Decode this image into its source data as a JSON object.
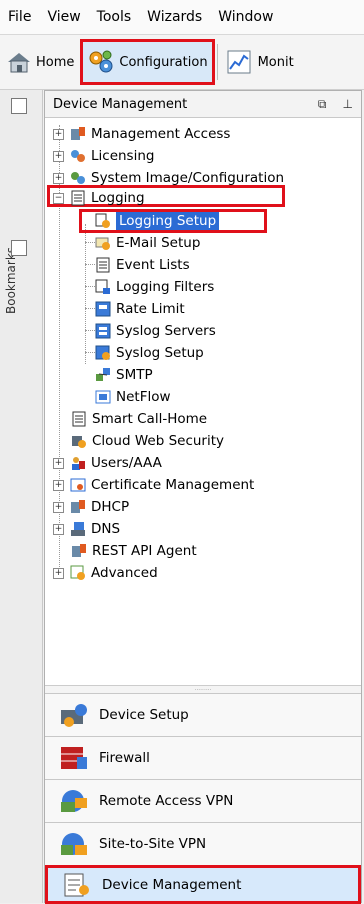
{
  "menubar": {
    "items": [
      "File",
      "View",
      "Tools",
      "Wizards",
      "Window"
    ]
  },
  "toolbar": {
    "home": "Home",
    "configuration": "Configuration",
    "monitoring": "Monit"
  },
  "bookmarks": {
    "label": "Bookmarks"
  },
  "panel": {
    "title": "Device Management",
    "restore_icon": "⧉",
    "pin_icon": "⊥"
  },
  "tree": {
    "management_access": "Management Access",
    "licensing": "Licensing",
    "system_image": "System Image/Configuration",
    "logging": "Logging",
    "logging_setup": "Logging Setup",
    "email_setup": "E-Mail Setup",
    "event_lists": "Event Lists",
    "logging_filters": "Logging Filters",
    "rate_limit": "Rate Limit",
    "syslog_servers": "Syslog Servers",
    "syslog_setup": "Syslog Setup",
    "smtp": "SMTP",
    "netflow": "NetFlow",
    "smart_call_home": "Smart Call-Home",
    "cloud_web_security": "Cloud Web Security",
    "users_aaa": "Users/AAA",
    "certificate_mgmt": "Certificate Management",
    "dhcp": "DHCP",
    "dns": "DNS",
    "rest_api": "REST API Agent",
    "advanced": "Advanced"
  },
  "nav": {
    "device_setup": "Device Setup",
    "firewall": "Firewall",
    "remote_access_vpn": "Remote Access VPN",
    "site_to_site_vpn": "Site-to-Site VPN",
    "device_management": "Device Management"
  },
  "colors": {
    "highlight": "#e0101a",
    "selection": "#2b6bd4",
    "active_nav": "#d7e9fb"
  }
}
